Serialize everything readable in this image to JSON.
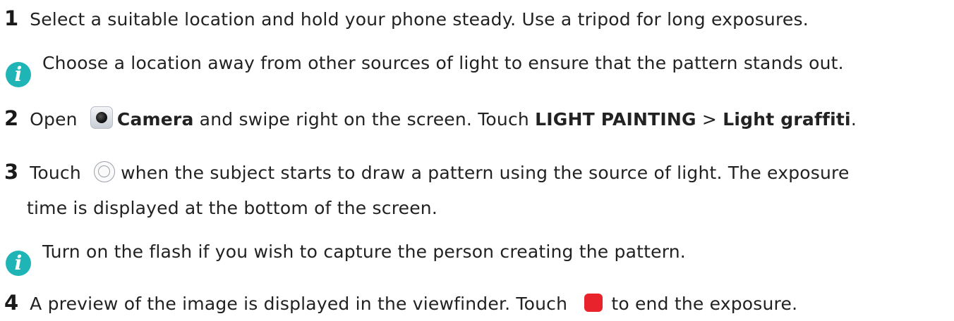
{
  "steps": [
    {
      "number": "1",
      "text": "Select a suitable location and hold your phone steady. Use a tripod for long exposures."
    },
    {
      "number": "2",
      "prefix": "Open",
      "camera_label": "Camera",
      "middle": "and swipe right on the screen. Touch",
      "menu_item": "LIGHT PAINTING",
      "separator": ">",
      "submenu_item": "Light graffiti",
      "end": "."
    },
    {
      "number": "3",
      "prefix": "Touch",
      "text_line1": "when the subject starts to draw a pattern using the source of light. The exposure",
      "text_line2": "time is displayed at the bottom of the screen."
    },
    {
      "number": "4",
      "prefix": "A preview of the image is displayed in the viewfinder. Touch",
      "suffix": "to end the exposure."
    }
  ],
  "notes": [
    {
      "text": "Choose a location away from other sources of light to ensure that the pattern stands out."
    },
    {
      "text": "Turn on the flash if you wish to capture the person creating the pattern."
    }
  ],
  "icons": {
    "info": "i",
    "camera": "camera-app-icon",
    "shutter": "shutter-button-icon",
    "stop": "stop-button-icon"
  },
  "colors": {
    "info_icon": "#1fb5b6",
    "stop_button": "#e8232b",
    "text": "#222222"
  }
}
